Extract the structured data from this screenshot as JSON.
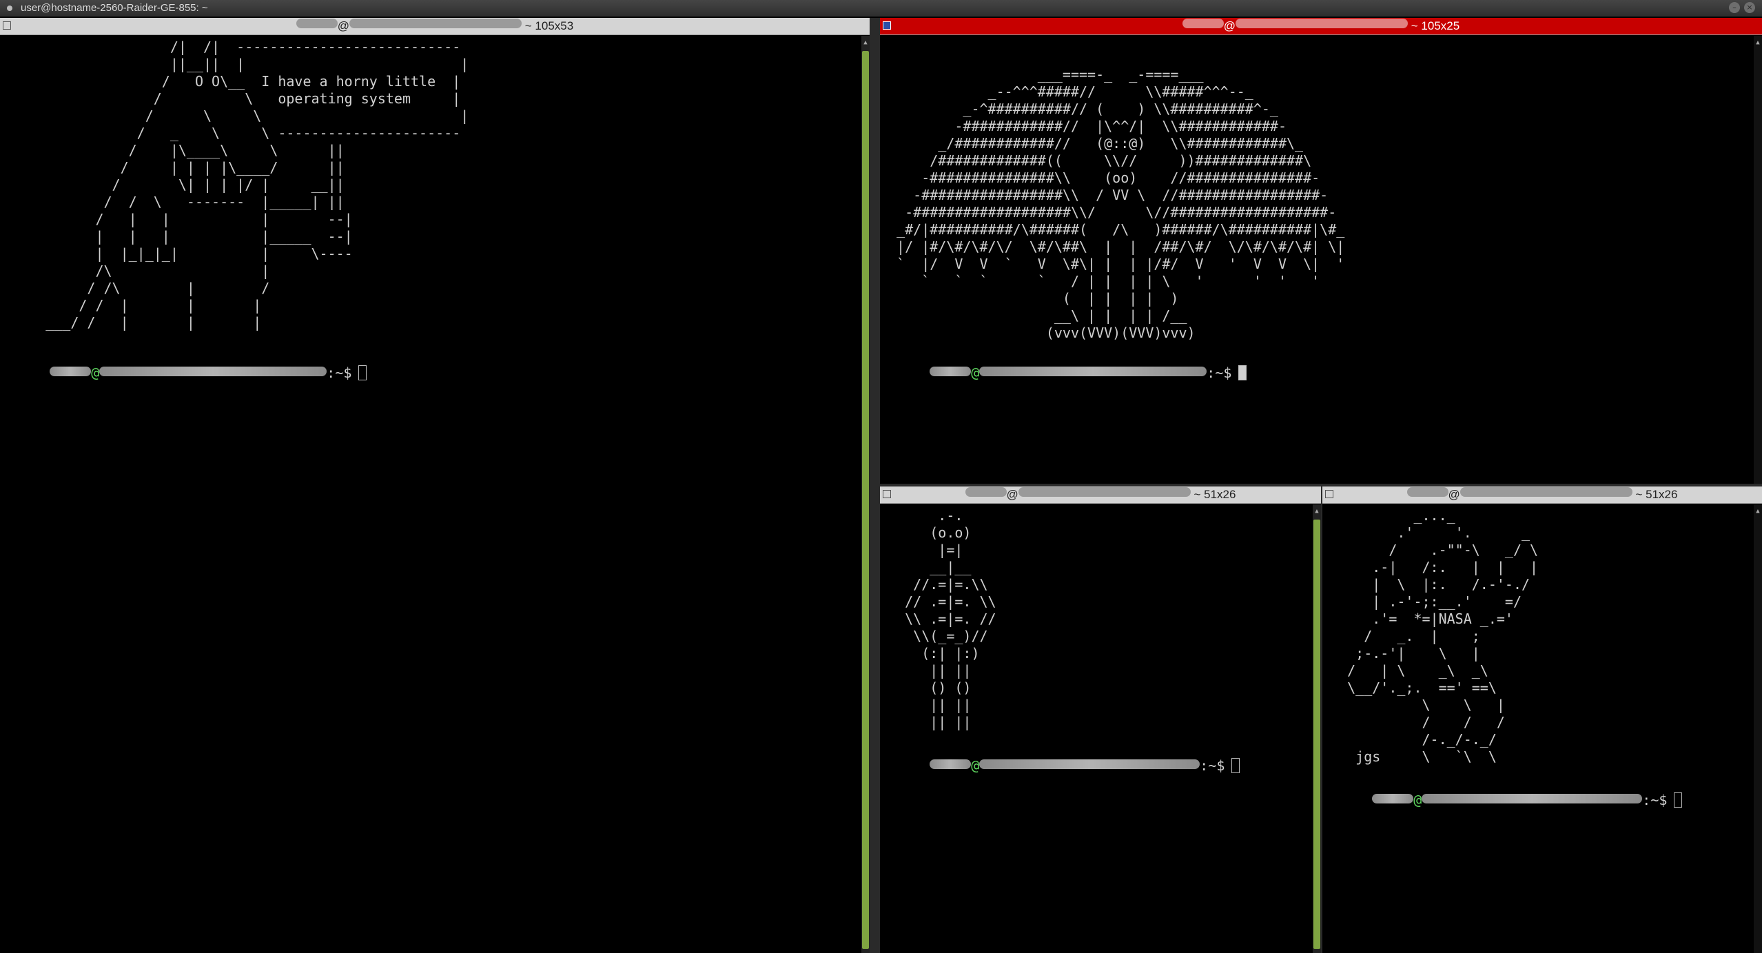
{
  "window": {
    "title": "user@hostname-2560-Raider-GE-855: ~"
  },
  "panes": {
    "left": {
      "title": "~ 105x53",
      "art": "                    /|  /|  ---------------------------\n                    ||__||  |                          |\n                   /   O O\\__  I have a horny little  |\n                  /          \\   operating system     |\n                 /      \\     \\                        |\n                /   _    \\     \\ ----------------------\n               /    |\\____\\     \\      ||\n              /     | | | |\\____/      ||\n             /       \\| | | |/ |     __||\n            /  /  \\   -------  |_____| ||\n           /   |   |           |       --|\n           |   |   |           |_____  --|\n           |  |_|_|_|          |     \\----\n           /\\                  |\n          / /\\        |        /\n         / /  |       |       |\n     ___/ /   |       |       |",
      "prompt_symbol": ":~$"
    },
    "top_right": {
      "title": "~ 105x25",
      "art": "                   ___====-_  _-====___\n             _--^^^#####//      \\\\#####^^^--_\n          _-^##########// (    ) \\\\##########^-_\n         -############//  |\\^^/|  \\\\############-\n       _/############//   (@::@)   \\\\############\\_\n      /#############((     \\\\//     ))#############\\\n     -###############\\\\    (oo)    //###############-\n    -#################\\\\  / VV \\  //#################-\n   -###################\\\\/      \\//###################-\n  _#/|##########/\\######(   /\\   )######/\\##########|\\#_\n  |/ |#/\\#/\\#/\\/  \\#/\\##\\  |  |  /##/\\#/  \\/\\#/\\#/\\#| \\|\n  `  |/  V  V  `   V  \\#\\| |  | |/#/  V   '  V  V  \\|  '\n     `   `  `      `   / | |  | | \\   '      '  '   '\n                      (  | |  | |  )\n                     __\\ | |  | | /__\n                    (vvv(VVV)(VVV)vvv)",
      "prompt_symbol": ":~$"
    },
    "bottom_mid": {
      "title": "~ 51x26",
      "art": "       .-.\n      (o.o)\n       |=|\n      __|__\n    //.=|=.\\\\\n   // .=|=. \\\\\n   \\\\ .=|=. //\n    \\\\(_=_)//\n     (:| |:)\n      || ||\n      () ()\n      || ||\n      || ||",
      "prompt_symbol": ":~$"
    },
    "bottom_right": {
      "title": "~ 51x26",
      "art": "           _..._\n         .'     '.      _\n        /    .-\"\"-\\   _/ \\\n      .-|   /:.   |  |   |\n      |  \\  |:.   /.-'-./\n      | .-'-;:__.'    =/\n      .'=  *=|NASA _.='\n     /   _.  |    ;\n    ;-.-'|    \\   |\n   /   | \\    _\\  _\\\n   \\__/'._;.  ==' ==\\\n            \\    \\   |\n            /    /   /\n            /-._/-._/\n    jgs     \\   `\\  \\",
      "prompt_symbol": ":~$"
    }
  },
  "colors": {
    "prompt_user": "#5fd75f",
    "active_title": "#c70000",
    "scroll_thumb": "#7fa441"
  }
}
